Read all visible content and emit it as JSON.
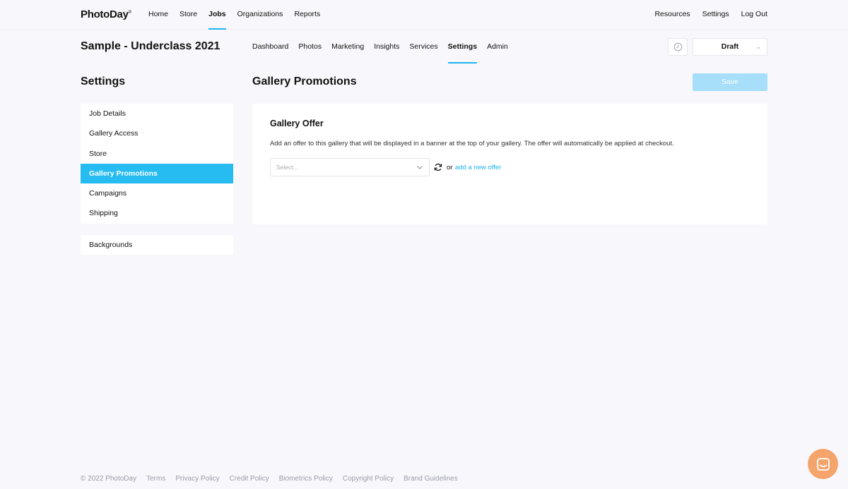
{
  "brand": {
    "logo": "PhotoDay",
    "trademark": "®"
  },
  "topnav": {
    "items": [
      {
        "label": "Home"
      },
      {
        "label": "Store"
      },
      {
        "label": "Jobs",
        "active": true
      },
      {
        "label": "Organizations"
      },
      {
        "label": "Reports"
      }
    ],
    "right_items": [
      {
        "label": "Resources"
      },
      {
        "label": "Settings"
      },
      {
        "label": "Log Out"
      }
    ]
  },
  "job": {
    "title": "Sample - Underclass 2021",
    "tabs": [
      {
        "label": "Dashboard"
      },
      {
        "label": "Photos"
      },
      {
        "label": "Marketing"
      },
      {
        "label": "Insights"
      },
      {
        "label": "Services"
      },
      {
        "label": "Settings",
        "active": true
      },
      {
        "label": "Admin"
      }
    ],
    "status": "Draft"
  },
  "sidebar": {
    "heading": "Settings",
    "items": [
      {
        "label": "Job Details"
      },
      {
        "label": "Gallery Access"
      },
      {
        "label": "Store"
      },
      {
        "label": "Gallery Promotions",
        "active": true
      },
      {
        "label": "Campaigns"
      },
      {
        "label": "Shipping"
      }
    ],
    "secondary_items": [
      {
        "label": "Backgrounds"
      }
    ]
  },
  "main": {
    "heading": "Gallery Promotions",
    "save_label": "Save",
    "card": {
      "title": "Gallery Offer",
      "description": "Add an offer to this gallery that will be displayed in a banner at the top of your gallery. The offer will automatically be applied at checkout.",
      "select_placeholder": "Select...",
      "or_text": "or",
      "add_link": "add a new offer"
    }
  },
  "footer": {
    "copyright": "© 2022 PhotoDay",
    "links": [
      {
        "label": "Terms"
      },
      {
        "label": "Privacy Policy"
      },
      {
        "label": "Credit Policy"
      },
      {
        "label": "Biometrics Policy"
      },
      {
        "label": "Copyright Policy"
      },
      {
        "label": "Brand Guidelines"
      }
    ]
  },
  "colors": {
    "accent": "#1fb3ef",
    "active_bg": "#26bcf1",
    "save_disabled": "#a7defa",
    "chat": "#f5a46c"
  },
  "icons": {
    "history": "clock-icon",
    "chevron": "chevron-down-icon",
    "refresh": "refresh-icon",
    "chat": "chat-icon"
  }
}
